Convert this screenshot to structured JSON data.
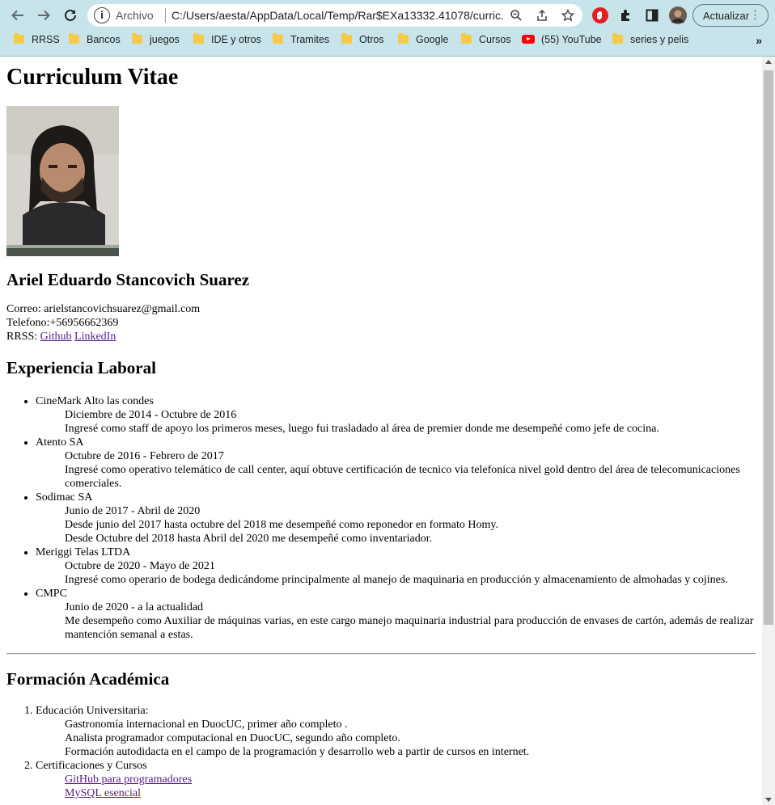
{
  "browser": {
    "omnibox": {
      "scheme_label": "Archivo",
      "url": "C:/Users/aesta/AppData/Local/Temp/Rar$EXa13332.41078/curric..."
    },
    "update_label": "Actualizar",
    "bookmarks": [
      {
        "label": "RRSS",
        "icon": "folder-icon"
      },
      {
        "label": "Bancos",
        "icon": "folder-icon"
      },
      {
        "label": "juegos",
        "icon": "folder-icon"
      },
      {
        "label": "IDE y otros",
        "icon": "folder-icon"
      },
      {
        "label": "Tramites",
        "icon": "folder-icon"
      },
      {
        "label": "Otros",
        "icon": "folder-icon"
      },
      {
        "label": "Google",
        "icon": "folder-icon"
      },
      {
        "label": "Cursos",
        "icon": "folder-icon"
      },
      {
        "label": "(55) YouTube",
        "icon": "youtube-icon"
      },
      {
        "label": "series y pelis",
        "icon": "folder-icon"
      }
    ],
    "bookmarks_more": "»",
    "accent_color": "#c7e4ea"
  },
  "page": {
    "title": "Curriculum Vitae",
    "name": "Ariel Eduardo Stancovich Suarez",
    "contact": {
      "email": "Correo: arielstancovichsuarez@gmail.com",
      "phone": "Telefono:+56956662369",
      "rrss_label": "RRSS:",
      "github": "Github",
      "linkedin": "LinkedIn"
    },
    "experience_heading": "Experiencia Laboral",
    "jobs": [
      {
        "company": "CineMark Alto las condes",
        "period": "Diciembre de 2014 - Octubre de 2016",
        "lines": [
          "Ingresé como staff de apoyo los primeros meses, luego fui trasladado al área de premier donde me desempeñé como jefe de cocina."
        ]
      },
      {
        "company": "Atento SA",
        "period": "Octubre de 2016 - Febrero de 2017",
        "lines": [
          "Ingresé como operativo telemático de call center, aquí obtuve certificación de tecnico via telefonica nivel gold dentro del área de telecomunicaciones comerciales."
        ]
      },
      {
        "company": "Sodimac SA",
        "period": "Junio de 2017 - Abril de 2020",
        "lines": [
          "Desde junio del 2017 hasta octubre del 2018 me desempeñé como reponedor en formato Homy.",
          "Desde Octubre del 2018 hasta Abril del 2020 me desempeñé como inventariador."
        ]
      },
      {
        "company": "Meriggi Telas LTDA",
        "period": "Octubre de 2020 - Mayo de 2021",
        "lines": [
          "Ingresé como operario de bodega dedicándome principalmente al manejo de maquinaria en producción y almacenamiento de almohadas y cojines."
        ]
      },
      {
        "company": "CMPC",
        "period": "Junio de 2020 - a la actualidad",
        "lines": [
          "Me desempeño como Auxiliar de máquinas varias, en este cargo manejo maquinaria industrial para producción de envases de cartón, además de realizar mantención semanal a estas."
        ]
      }
    ],
    "education_heading": "Formación Académica",
    "education": {
      "university_label": "Educación Universitaria:",
      "university_lines": [
        "Gastronomía internacional en DuocUC, primer año completo .",
        "Analista programador computacional en DuocUC, segundo año completo.",
        "Formación autodidacta en el campo de la programación y desarrollo web a partir de cursos en internet."
      ],
      "certs_label": "Certificaciones y Cursos",
      "certs_links": [
        "GitHub para programadores",
        "MySQL esencial"
      ]
    }
  }
}
